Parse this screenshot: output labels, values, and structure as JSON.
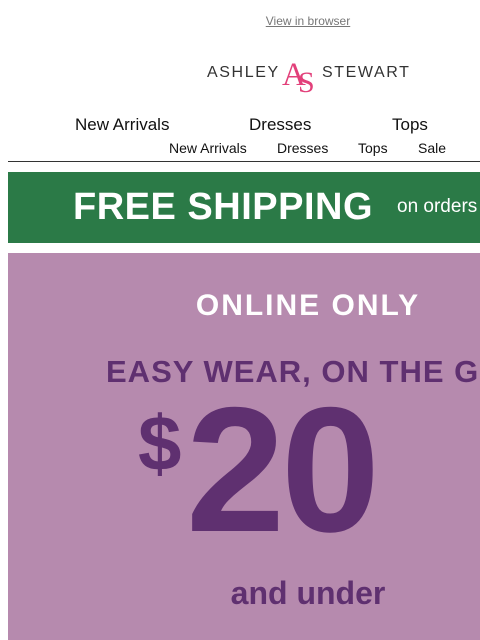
{
  "header": {
    "view_in_browser": "View in browser"
  },
  "logo": {
    "word_left": "ASHLEY",
    "word_right": "STEWART",
    "monogram": "AS",
    "brand_color": "#e2407a"
  },
  "nav_primary": [
    "New Arrivals",
    "Dresses",
    "Tops"
  ],
  "nav_secondary": [
    "New Arrivals",
    "Dresses",
    "Tops",
    "Sale"
  ],
  "shipping_banner": {
    "headline": "FREE SHIPPING",
    "subtext": "on orders",
    "background": "#2b7a47"
  },
  "promo": {
    "tag": "ONLINE ONLY",
    "headline": "EASY WEAR, ON THE G",
    "currency": "$",
    "amount": "20",
    "suffix": "and under",
    "background": "#b68aae",
    "accent": "#5f3070"
  }
}
